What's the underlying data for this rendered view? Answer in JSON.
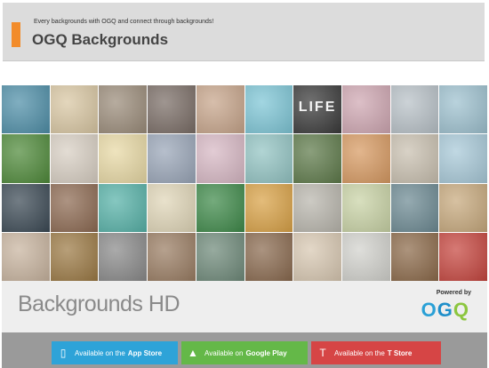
{
  "header": {
    "tagline": "Every backgrounds with OGQ and connect through backgrounds!",
    "title": "OGQ Backgrounds",
    "accent_color": "#f28c2b"
  },
  "mosaic": {
    "tiles": [
      {
        "color": "#4f8fa8",
        "label": ""
      },
      {
        "color": "#d9c7a3",
        "label": ""
      },
      {
        "color": "#9b8c7a",
        "label": ""
      },
      {
        "color": "#7a6d66",
        "label": ""
      },
      {
        "color": "#c7a58b",
        "label": ""
      },
      {
        "color": "#7ec6d6",
        "label": ""
      },
      {
        "color": "#3a3a3a",
        "label": "LIFE"
      },
      {
        "color": "#cfa7b2",
        "label": ""
      },
      {
        "color": "#b8c1c7",
        "label": ""
      },
      {
        "color": "#9ec1cf",
        "label": ""
      },
      {
        "color": "#4f8a3a",
        "label": ""
      },
      {
        "color": "#d8cfc3",
        "label": ""
      },
      {
        "color": "#e8d9a5",
        "label": ""
      },
      {
        "color": "#9aa6b8",
        "label": ""
      },
      {
        "color": "#d7b8c4",
        "label": ""
      },
      {
        "color": "#93c4c3",
        "label": ""
      },
      {
        "color": "#5e7a4a",
        "label": ""
      },
      {
        "color": "#d79a62",
        "label": ""
      },
      {
        "color": "#c9c0b0",
        "label": ""
      },
      {
        "color": "#a8c9d8",
        "label": ""
      },
      {
        "color": "#3c4a55",
        "label": ""
      },
      {
        "color": "#8d6a52",
        "label": ""
      },
      {
        "color": "#57b2a8",
        "label": ""
      },
      {
        "color": "#e0d6b8",
        "label": ""
      },
      {
        "color": "#3f8a4a",
        "label": ""
      },
      {
        "color": "#d9a247",
        "label": ""
      },
      {
        "color": "#b9b6ad",
        "label": ""
      },
      {
        "color": "#c9d3a6",
        "label": ""
      },
      {
        "color": "#6d8a93",
        "label": ""
      },
      {
        "color": "#c7a97d",
        "label": ""
      },
      {
        "color": "#c8b49f",
        "label": ""
      },
      {
        "color": "#9c7a45",
        "label": ""
      },
      {
        "color": "#8a8a8a",
        "label": ""
      },
      {
        "color": "#9a7d63",
        "label": ""
      },
      {
        "color": "#6f8a7a",
        "label": ""
      },
      {
        "color": "#8a6a4f",
        "label": ""
      },
      {
        "color": "#d8c8b2",
        "label": ""
      },
      {
        "color": "#d2d2cd",
        "label": ""
      },
      {
        "color": "#8c6a4a",
        "label": ""
      },
      {
        "color": "#c6463f",
        "label": ""
      }
    ]
  },
  "product": {
    "name": "Backgrounds",
    "suffix": " HD",
    "powered_by": "Powered by",
    "logo": {
      "o1": "O",
      "g": "G",
      "o2": "Q"
    }
  },
  "stores": {
    "app": {
      "prefix": "Available on the",
      "name": "App Store",
      "color": "#2ea3d8"
    },
    "play": {
      "prefix": "Available on",
      "name": "Google Play",
      "color": "#64b848"
    },
    "t": {
      "prefix": "Available on the",
      "name": "T Store",
      "color": "#d64545"
    }
  }
}
